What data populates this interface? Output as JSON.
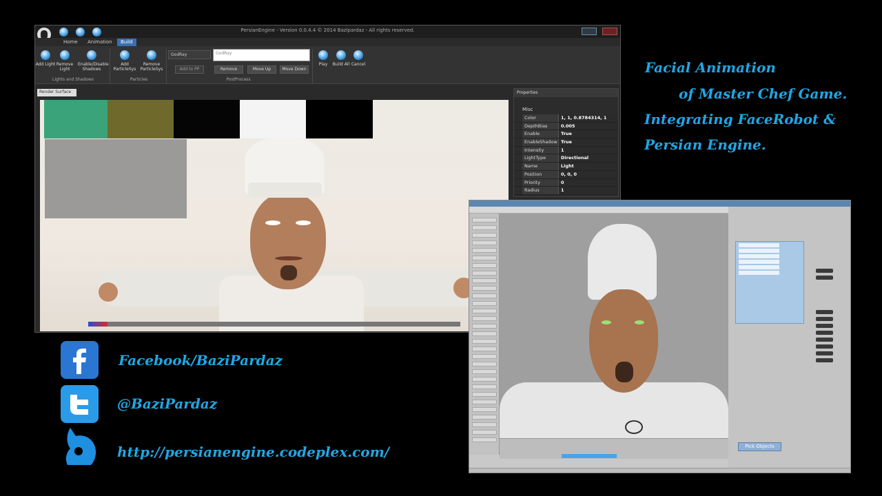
{
  "editor": {
    "window_title": "PersianEngine - Version 0.0.4.4 © 2014 Bazipardaz - All rights reserved.",
    "tabs": [
      "Home",
      "Animation",
      "Build"
    ],
    "active_tab": "Build",
    "ribbon": {
      "add_light": "Add Light",
      "remove_light": "Remove Light",
      "enable_shadows": "Enable/Disable Shadows",
      "group_lights": "Lights and Shadows",
      "add_particle": "Add ParticleSys",
      "remove_particle": "Remove ParticleSys",
      "group_particles": "Particles",
      "postprocess_select": "GodRay",
      "postprocess_text": "GodRay",
      "add_to_pp": "Add to PP",
      "remove": "Remove",
      "move_up": "Move Up",
      "move_down": "Move Down",
      "group_postprocess": "PostProcess",
      "play": "Play",
      "build_all": "Build All",
      "cancel": "Cancel"
    },
    "render_surface_label": "Render Surface",
    "properties": {
      "header": "Properties",
      "category": "Misc",
      "rows": [
        {
          "key": "Color",
          "value": "1, 1, 0.8784314, 1"
        },
        {
          "key": "DepthBias",
          "value": "0.005"
        },
        {
          "key": "Enable",
          "value": "True"
        },
        {
          "key": "EnableShadow",
          "value": "True"
        },
        {
          "key": "Intensity",
          "value": "1"
        },
        {
          "key": "LightType",
          "value": "Directional"
        },
        {
          "key": "Name",
          "value": "Light"
        },
        {
          "key": "Position",
          "value": "0, 0, 0"
        },
        {
          "key": "Priority",
          "value": "0"
        },
        {
          "key": "Radius",
          "value": "1"
        }
      ]
    }
  },
  "caption": {
    "line1": "Facial Animation",
    "line2": "of Master Chef Game.",
    "line3": "Integrating FaceRobot &",
    "line4": "Persian Engine."
  },
  "social": {
    "facebook": "Facebook/BaziPardaz",
    "twitter": "@BaziPardaz",
    "website": "http://persianengine.codeplex.com/"
  },
  "softimage": {
    "pick_objects": "Pick Objects"
  }
}
